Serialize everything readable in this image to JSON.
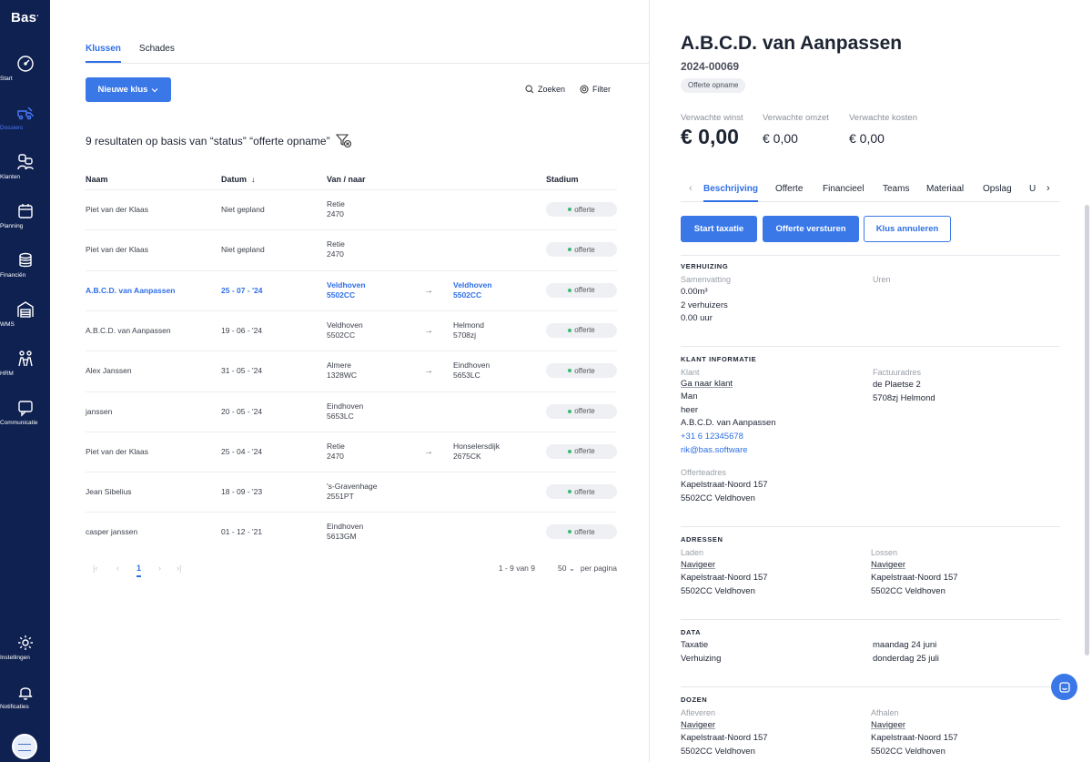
{
  "sidebar": {
    "logo": "Bas",
    "items": [
      {
        "label": "Start",
        "icon": "gauge-icon"
      },
      {
        "label": "Dossiers",
        "icon": "truck-icon",
        "active": true
      },
      {
        "label": "Klanten",
        "icon": "users-icon"
      },
      {
        "label": "Planning",
        "icon": "calendar-icon"
      },
      {
        "label": "Financiën",
        "icon": "coins-icon"
      },
      {
        "label": "WMS",
        "icon": "warehouse-icon"
      },
      {
        "label": "HRM",
        "icon": "people-icon"
      },
      {
        "label": "Communicatie",
        "icon": "chat-bubble-icon"
      }
    ],
    "bottom": [
      {
        "label": "Instellingen",
        "icon": "gear-icon"
      },
      {
        "label": "Notificaties",
        "icon": "bell-icon"
      }
    ]
  },
  "main": {
    "tabs": [
      "Klussen",
      "Schades"
    ],
    "new_button": "Nieuwe klus",
    "search": "Zoeken",
    "filter": "Filter",
    "result_title": "9 resultaten op basis van “status” “offerte opname”",
    "columns": {
      "name": "Naam",
      "date": "Datum",
      "route": "Van / naar",
      "stage": "Stadium"
    },
    "rows": [
      {
        "name": "Piet van der Klaas",
        "date": "Niet gepland",
        "from1": "Retie",
        "from2": "2470",
        "arrow": "",
        "to1": "",
        "to2": "",
        "stage": "offerte"
      },
      {
        "name": "Piet van der Klaas",
        "date": "Niet gepland",
        "from1": "Retie",
        "from2": "2470",
        "arrow": "",
        "to1": "",
        "to2": "",
        "stage": "offerte"
      },
      {
        "name": "A.B.C.D. van Aanpassen",
        "date": "25 - 07 - '24",
        "from1": "Veldhoven",
        "from2": "5502CC",
        "arrow": "→",
        "to1": "Veldhoven",
        "to2": "5502CC",
        "stage": "offerte"
      },
      {
        "name": "A.B.C.D. van Aanpassen",
        "date": "19 - 06 - '24",
        "from1": "Veldhoven",
        "from2": "5502CC",
        "arrow": "→",
        "to1": "Helmond",
        "to2": "5708zj",
        "stage": "offerte"
      },
      {
        "name": "Alex Janssen",
        "date": "31 - 05 - '24",
        "from1": "Almere",
        "from2": "1328WC",
        "arrow": "→",
        "to1": "Eindhoven",
        "to2": "5653LC",
        "stage": "offerte"
      },
      {
        "name": "janssen",
        "date": "20 - 05 - '24",
        "from1": "Eindhoven",
        "from2": "5653LC",
        "arrow": "",
        "to1": "",
        "to2": "",
        "stage": "offerte"
      },
      {
        "name": "Piet van der Klaas",
        "date": "25 - 04 - '24",
        "from1": "Retie",
        "from2": "2470",
        "arrow": "→",
        "to1": "Honselersdijk",
        "to2": "2675CK",
        "stage": "offerte"
      },
      {
        "name": "Jean Sibelius",
        "date": "18 - 09 - '23",
        "from1": "'s-Gravenhage",
        "from2": "2551PT",
        "arrow": "",
        "to1": "",
        "to2": "",
        "stage": "offerte"
      },
      {
        "name": "casper janssen",
        "date": "01 - 12 - '21",
        "from1": "Eindhoven",
        "from2": "5613GM",
        "arrow": "",
        "to1": "",
        "to2": "",
        "stage": "offerte"
      }
    ],
    "pagination": {
      "first": "|‹",
      "prev": "‹",
      "page": "1",
      "next": "›",
      "last": "›|",
      "info": "1 - 9 van 9",
      "per_page_value": "50",
      "per_page_label": "per pagina"
    }
  },
  "detail": {
    "title": "A.B.C.D. van Aanpassen",
    "number": "2024-00069",
    "badge": "Offerte opname",
    "finance": {
      "profit_label": "Verwachte winst",
      "profit": "€ 0,00",
      "revenue_label": "Verwachte omzet",
      "revenue": "€ 0,00",
      "cost_label": "Verwachte kosten",
      "cost": "€ 0,00"
    },
    "tabs": [
      "Beschrijving",
      "Offerte",
      "Financieel",
      "Teams",
      "Materiaal",
      "Opslag",
      "U"
    ],
    "actions": [
      "Start taxatie",
      "Offerte versturen",
      "Klus annuleren"
    ],
    "verhuizing": {
      "title": "VERHUIZING",
      "summary_label": "Samenvatting",
      "hours_label": "Uren",
      "lines": [
        "0.00m³",
        "2 verhuizers",
        "0.00 uur"
      ]
    },
    "klant": {
      "title": "KLANT INFORMATIE",
      "client_label": "Klant",
      "goto": "Ga naar klant",
      "gender": "Man",
      "salutation": "heer",
      "name": "A.B.C.D. van Aanpassen",
      "phone": "+31 6 12345678",
      "email": "rik@bas.software",
      "invoice_label": "Factuuradres",
      "invoice_street": "de Plaetse 2",
      "invoice_city": "5708zj Helmond",
      "quote_label": "Offerteadres",
      "quote_street": "Kapelstraat-Noord 157",
      "quote_city": "5502CC Veldhoven"
    },
    "adressen": {
      "title": "ADRESSEN",
      "load_label": "Laden",
      "load_nav": "Navigeer",
      "load_street": "Kapelstraat-Noord 157",
      "load_city": "5502CC Veldhoven",
      "unload_label": "Lossen",
      "unload_nav": "Navigeer",
      "unload_street": "Kapelstraat-Noord 157",
      "unload_city": "5502CC Veldhoven"
    },
    "data": {
      "title": "DATA",
      "taxatie_label": "Taxatie",
      "taxatie_value": "maandag 24 juni",
      "move_label": "Verhuizing",
      "move_value": "donderdag 25 juli"
    },
    "dozen": {
      "title": "DOZEN",
      "deliver_label": "Afleveren",
      "deliver_nav": "Navigeer",
      "deliver_street": "Kapelstraat-Noord 157",
      "deliver_city": "5502CC Veldhoven",
      "pickup_label": "Afhalen",
      "pickup_nav": "Navigeer",
      "pickup_street": "Kapelstraat-Noord 157",
      "pickup_city": "5502CC Veldhoven"
    }
  },
  "colors": {
    "sidebar": "#0f2150",
    "accent": "#3a78e8",
    "success": "#3cb878"
  }
}
